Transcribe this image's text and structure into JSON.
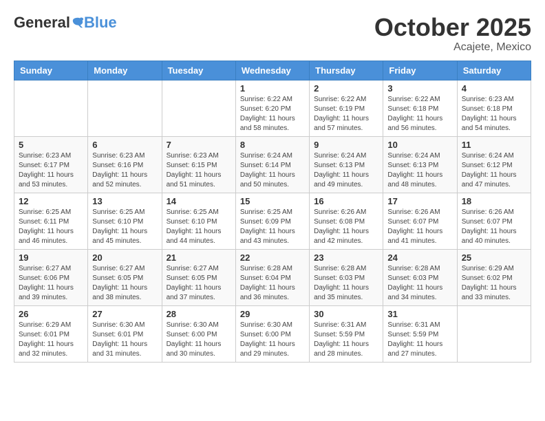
{
  "header": {
    "logo_general": "General",
    "logo_blue": "Blue",
    "month_title": "October 2025",
    "location": "Acajete, Mexico"
  },
  "days_of_week": [
    "Sunday",
    "Monday",
    "Tuesday",
    "Wednesday",
    "Thursday",
    "Friday",
    "Saturday"
  ],
  "weeks": [
    [
      {
        "day": "",
        "info": ""
      },
      {
        "day": "",
        "info": ""
      },
      {
        "day": "",
        "info": ""
      },
      {
        "day": "1",
        "info": "Sunrise: 6:22 AM\nSunset: 6:20 PM\nDaylight: 11 hours\nand 58 minutes."
      },
      {
        "day": "2",
        "info": "Sunrise: 6:22 AM\nSunset: 6:19 PM\nDaylight: 11 hours\nand 57 minutes."
      },
      {
        "day": "3",
        "info": "Sunrise: 6:22 AM\nSunset: 6:18 PM\nDaylight: 11 hours\nand 56 minutes."
      },
      {
        "day": "4",
        "info": "Sunrise: 6:23 AM\nSunset: 6:18 PM\nDaylight: 11 hours\nand 54 minutes."
      }
    ],
    [
      {
        "day": "5",
        "info": "Sunrise: 6:23 AM\nSunset: 6:17 PM\nDaylight: 11 hours\nand 53 minutes."
      },
      {
        "day": "6",
        "info": "Sunrise: 6:23 AM\nSunset: 6:16 PM\nDaylight: 11 hours\nand 52 minutes."
      },
      {
        "day": "7",
        "info": "Sunrise: 6:23 AM\nSunset: 6:15 PM\nDaylight: 11 hours\nand 51 minutes."
      },
      {
        "day": "8",
        "info": "Sunrise: 6:24 AM\nSunset: 6:14 PM\nDaylight: 11 hours\nand 50 minutes."
      },
      {
        "day": "9",
        "info": "Sunrise: 6:24 AM\nSunset: 6:13 PM\nDaylight: 11 hours\nand 49 minutes."
      },
      {
        "day": "10",
        "info": "Sunrise: 6:24 AM\nSunset: 6:13 PM\nDaylight: 11 hours\nand 48 minutes."
      },
      {
        "day": "11",
        "info": "Sunrise: 6:24 AM\nSunset: 6:12 PM\nDaylight: 11 hours\nand 47 minutes."
      }
    ],
    [
      {
        "day": "12",
        "info": "Sunrise: 6:25 AM\nSunset: 6:11 PM\nDaylight: 11 hours\nand 46 minutes."
      },
      {
        "day": "13",
        "info": "Sunrise: 6:25 AM\nSunset: 6:10 PM\nDaylight: 11 hours\nand 45 minutes."
      },
      {
        "day": "14",
        "info": "Sunrise: 6:25 AM\nSunset: 6:10 PM\nDaylight: 11 hours\nand 44 minutes."
      },
      {
        "day": "15",
        "info": "Sunrise: 6:25 AM\nSunset: 6:09 PM\nDaylight: 11 hours\nand 43 minutes."
      },
      {
        "day": "16",
        "info": "Sunrise: 6:26 AM\nSunset: 6:08 PM\nDaylight: 11 hours\nand 42 minutes."
      },
      {
        "day": "17",
        "info": "Sunrise: 6:26 AM\nSunset: 6:07 PM\nDaylight: 11 hours\nand 41 minutes."
      },
      {
        "day": "18",
        "info": "Sunrise: 6:26 AM\nSunset: 6:07 PM\nDaylight: 11 hours\nand 40 minutes."
      }
    ],
    [
      {
        "day": "19",
        "info": "Sunrise: 6:27 AM\nSunset: 6:06 PM\nDaylight: 11 hours\nand 39 minutes."
      },
      {
        "day": "20",
        "info": "Sunrise: 6:27 AM\nSunset: 6:05 PM\nDaylight: 11 hours\nand 38 minutes."
      },
      {
        "day": "21",
        "info": "Sunrise: 6:27 AM\nSunset: 6:05 PM\nDaylight: 11 hours\nand 37 minutes."
      },
      {
        "day": "22",
        "info": "Sunrise: 6:28 AM\nSunset: 6:04 PM\nDaylight: 11 hours\nand 36 minutes."
      },
      {
        "day": "23",
        "info": "Sunrise: 6:28 AM\nSunset: 6:03 PM\nDaylight: 11 hours\nand 35 minutes."
      },
      {
        "day": "24",
        "info": "Sunrise: 6:28 AM\nSunset: 6:03 PM\nDaylight: 11 hours\nand 34 minutes."
      },
      {
        "day": "25",
        "info": "Sunrise: 6:29 AM\nSunset: 6:02 PM\nDaylight: 11 hours\nand 33 minutes."
      }
    ],
    [
      {
        "day": "26",
        "info": "Sunrise: 6:29 AM\nSunset: 6:01 PM\nDaylight: 11 hours\nand 32 minutes."
      },
      {
        "day": "27",
        "info": "Sunrise: 6:30 AM\nSunset: 6:01 PM\nDaylight: 11 hours\nand 31 minutes."
      },
      {
        "day": "28",
        "info": "Sunrise: 6:30 AM\nSunset: 6:00 PM\nDaylight: 11 hours\nand 30 minutes."
      },
      {
        "day": "29",
        "info": "Sunrise: 6:30 AM\nSunset: 6:00 PM\nDaylight: 11 hours\nand 29 minutes."
      },
      {
        "day": "30",
        "info": "Sunrise: 6:31 AM\nSunset: 5:59 PM\nDaylight: 11 hours\nand 28 minutes."
      },
      {
        "day": "31",
        "info": "Sunrise: 6:31 AM\nSunset: 5:59 PM\nDaylight: 11 hours\nand 27 minutes."
      },
      {
        "day": "",
        "info": ""
      }
    ]
  ]
}
